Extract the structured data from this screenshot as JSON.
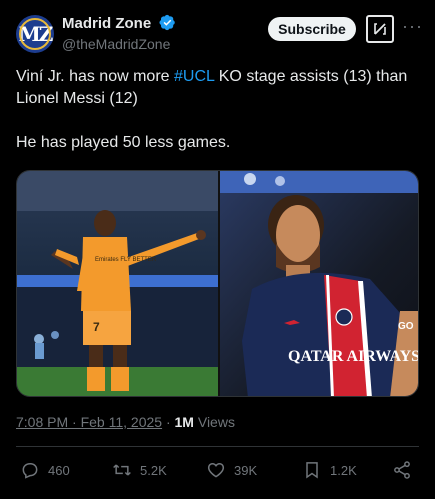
{
  "author": {
    "name": "Madrid Zone",
    "handle": "@theMadridZone",
    "avatar_text": "MZ"
  },
  "header": {
    "subscribe_label": "Subscribe",
    "grok_icon": "grok-icon",
    "more_icon": "more-icon"
  },
  "tweet": {
    "line1_pre": "Viní Jr. has now more ",
    "hashtag": "#UCL",
    "line1_post": " KO stage assists (13) than Lionel Messi (12)",
    "line2": "He has played 50 less games."
  },
  "media": {
    "left_caption_number": "7",
    "left_jersey_text": "Emirates FLY BETTER",
    "right_sponsor": "QATAR AIRWAYS",
    "right_badge": "GO"
  },
  "meta": {
    "time": "7:08 PM · Feb 11, 2025",
    "separator": " · ",
    "views_count": "1M",
    "views_label": " Views"
  },
  "actions": {
    "replies": "460",
    "reposts": "5.2K",
    "likes": "39K",
    "bookmarks": "1.2K"
  },
  "colors": {
    "accent": "#1d9bf0",
    "background": "#000000",
    "secondary_text": "#71767b"
  }
}
